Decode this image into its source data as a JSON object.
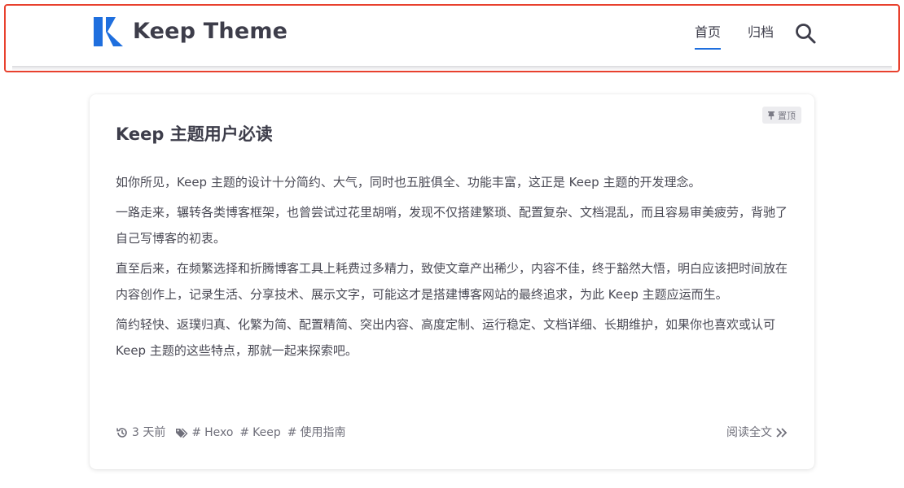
{
  "header": {
    "brand": "Keep Theme",
    "nav": [
      {
        "label": "首页",
        "active": true
      },
      {
        "label": "归档",
        "active": false
      }
    ],
    "search_icon": "search-icon",
    "accent_color": "#1f6fde"
  },
  "post": {
    "pinned_label": "置顶",
    "title": "Keep 主题用户必读",
    "paragraphs": [
      "如你所见，Keep 主题的设计十分简约、大气，同时也五脏俱全、功能丰富，这正是 Keep 主题的开发理念。",
      "一路走来，辗转各类博客框架，也曾尝试过花里胡哨，发现不仅搭建繁琐、配置复杂、文档混乱，而且容易审美疲劳，背驰了自己写博客的初衷。",
      "直至后来，在频繁选择和折腾博客工具上耗费过多精力，致使文章产出稀少，内容不佳，终于豁然大悟，明白应该把时间放在内容创作上，记录生活、分享技术、展示文字，可能这才是搭建博客网站的最终追求，为此 Keep 主题应运而生。",
      "简约轻快、返璞归真、化繁为简、配置精简、突出内容、高度定制、运行稳定、文档详细、长期维护，如果你也喜欢或认可 Keep 主题的这些特点，那就一起来探索吧。"
    ],
    "time": "3 天前",
    "tags": [
      "Hexo",
      "Keep",
      "使用指南"
    ],
    "read_more": "阅读全文"
  }
}
